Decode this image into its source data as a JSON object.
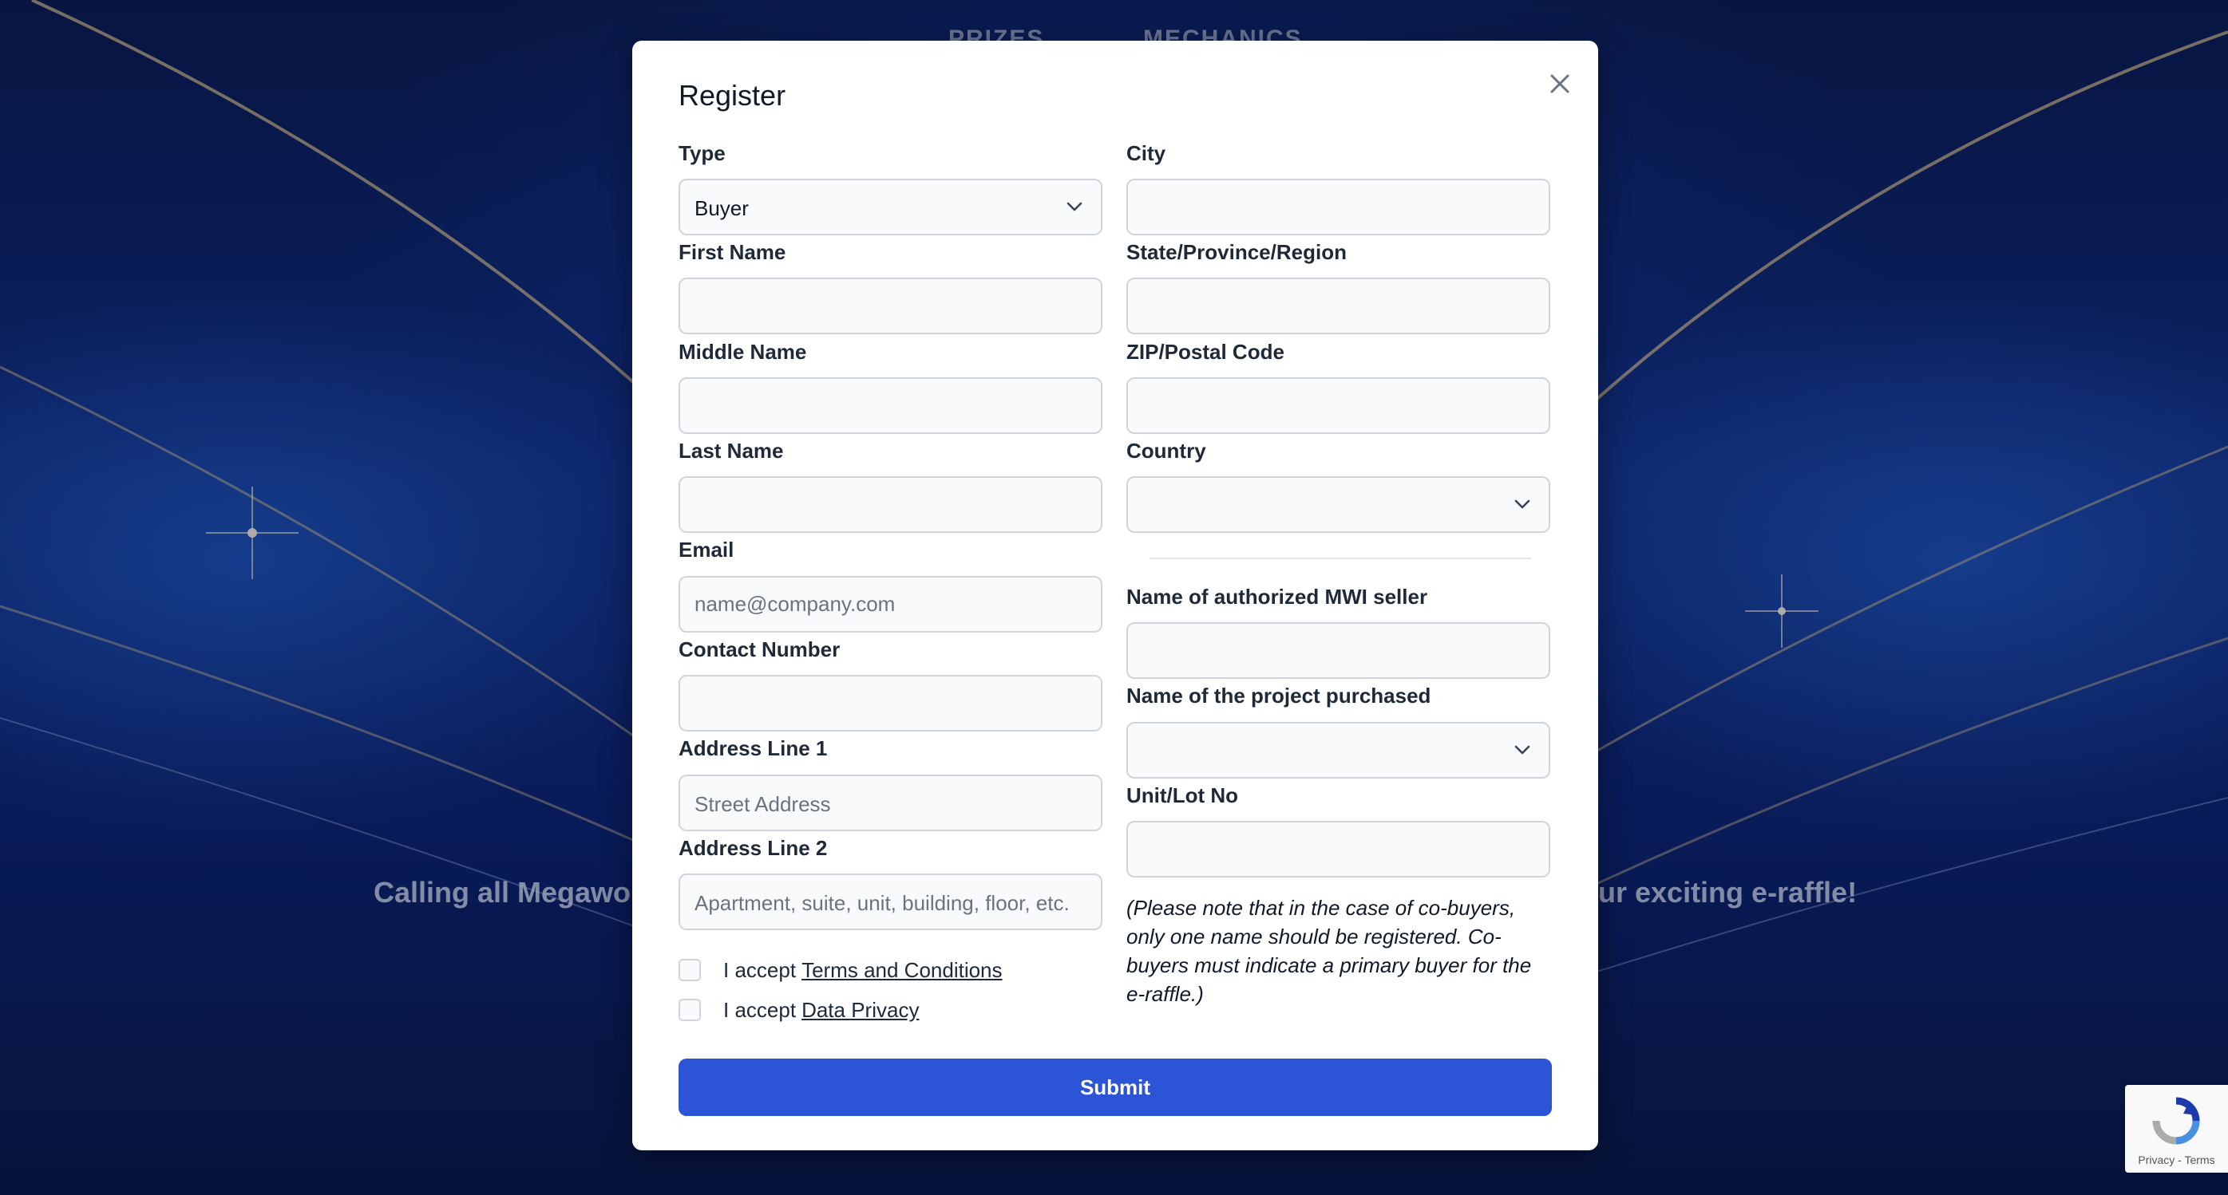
{
  "background": {
    "nav": [
      "PRIZES",
      "MECHANICS"
    ],
    "hero_left": "Calling all Megawor",
    "hero_right": "ur exciting e-raffle!"
  },
  "modal": {
    "title": "Register",
    "left": {
      "type_label": "Type",
      "type_value": "Buyer",
      "first_name_label": "First Name",
      "middle_name_label": "Middle Name",
      "last_name_label": "Last Name",
      "email_label": "Email",
      "email_placeholder": "name@company.com",
      "contact_label": "Contact Number",
      "address1_label": "Address Line 1",
      "address1_placeholder": "Street Address",
      "address2_label": "Address Line 2",
      "address2_placeholder": "Apartment, suite, unit, building, floor, etc.",
      "terms_prefix": "I accept",
      "terms_link": "Terms and Conditions",
      "privacy_prefix": "I accept",
      "privacy_link": "Data Privacy"
    },
    "right": {
      "city_label": "City",
      "state_label": "State/Province/Region",
      "zip_label": "ZIP/Postal Code",
      "country_label": "Country",
      "country_value": "",
      "seller_label": "Name of authorized MWI seller",
      "project_label": "Name of the project purchased",
      "project_value": "",
      "unit_label": "Unit/Lot No",
      "note": "(Please note that in the case of co-buyers, only one name should be registered. Co-buyers must indicate a primary buyer for the e-raffle.)"
    },
    "submit_label": "Submit"
  },
  "recaptcha": {
    "links": "Privacy - Terms"
  },
  "icons": {
    "close": "close-icon",
    "chevron": "chevron-down-icon",
    "recaptcha": "recaptcha-logo-icon"
  },
  "colors": {
    "primary": "#2b55d6",
    "background": "#0b1a4f"
  }
}
